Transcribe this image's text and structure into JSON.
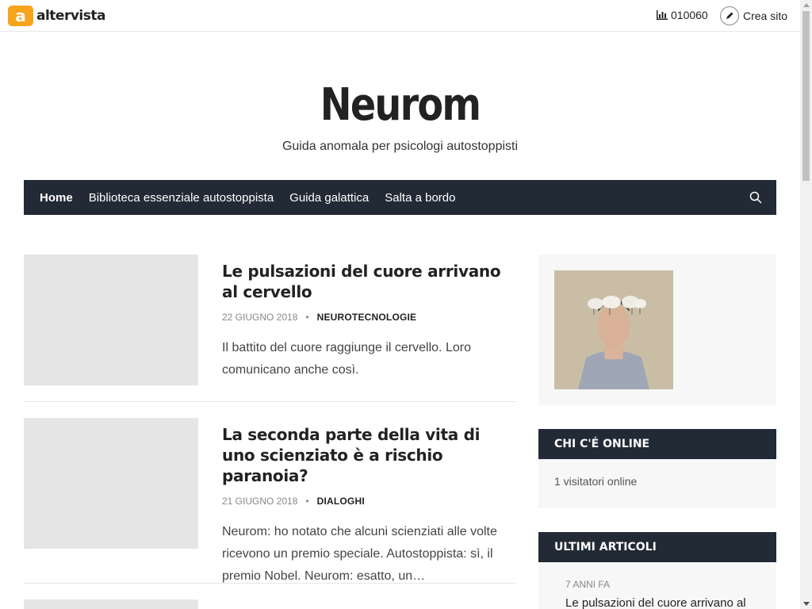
{
  "topbar": {
    "brand_letter": "a",
    "brand_name": "altervista",
    "stats_count": "010060",
    "create_label": "Crea sito",
    "colors": {
      "brand": "#f7a41d"
    }
  },
  "header": {
    "title": "Neurom",
    "tagline": "Guida anomala per psicologi autostoppisti"
  },
  "nav": {
    "items": [
      {
        "label": "Home"
      },
      {
        "label": "Biblioteca essenziale autostoppista"
      },
      {
        "label": "Guida galattica"
      },
      {
        "label": "Salta a bordo"
      }
    ],
    "search_icon": "search-icon"
  },
  "posts": [
    {
      "title": "Le pulsazioni del cuore arrivano al cervello",
      "date": "22 GIUGNO 2018",
      "category": "NEUROTECNOLOGIE",
      "excerpt": " Il battito del cuore raggiunge il cervello. Loro comunicano anche così."
    },
    {
      "title": "La seconda parte della vita di uno scienziato è a rischio paranoia?",
      "date": "21 GIUGNO 2018",
      "category": "DIALOGHI",
      "excerpt": "Neurom: ho notato che alcuni scienziati alle volte ricevono un premio speciale. Autostoppista: sì, il premio Nobel. Neurom: esatto, un…"
    }
  ],
  "sidebar": {
    "online": {
      "heading": "CHI C'É ONLINE",
      "text": "1 visitatori online"
    },
    "recent": {
      "heading": "ULTIMI ARTICOLI",
      "time": "7 ANNI FA",
      "title": "Le pulsazioni del cuore arrivano al cervello"
    }
  },
  "colors": {
    "nav_bg": "#222a35",
    "thumb_placeholder": "#e5e5e5"
  }
}
